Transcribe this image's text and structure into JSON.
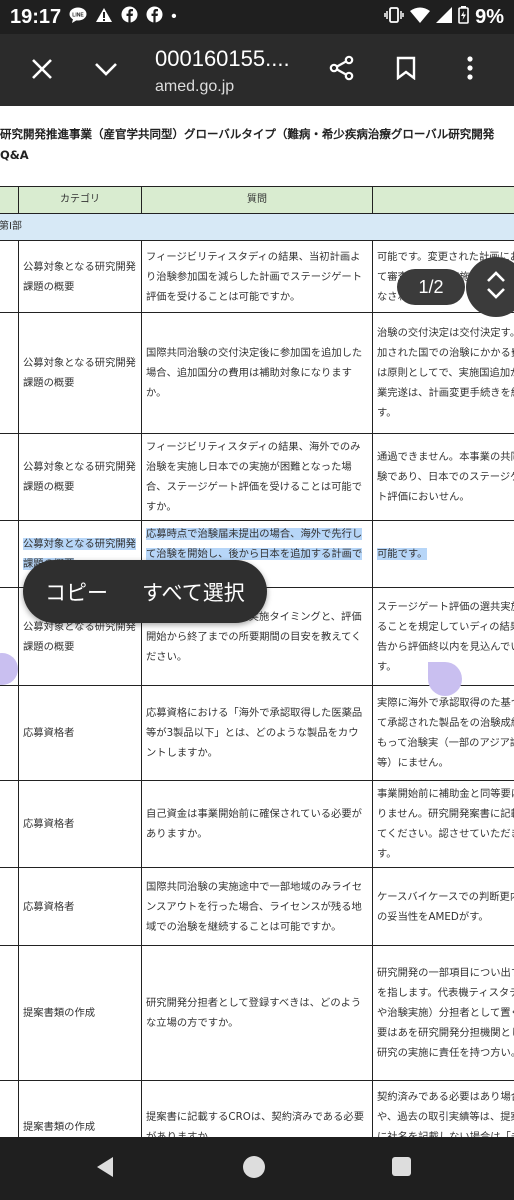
{
  "status_bar": {
    "time": "19:17",
    "dot": "•",
    "battery": "9%",
    "icons": [
      "line-app-icon",
      "alert-triangle-icon",
      "facebook-icon",
      "facebook-icon",
      "vibrate-icon",
      "wifi-icon",
      "signal-icon",
      "battery-charging-icon"
    ]
  },
  "toolbar": {
    "title": "000160155....",
    "url": "amed.go.jp"
  },
  "doc": {
    "title": "研究開発推進事業（産官学共同型）グローバルタイプ（難病・希少疾病治療グローバル研究開発",
    "subtitle": "Q&A"
  },
  "table": {
    "headers": [
      "カテゴリ",
      "質問"
    ],
    "part": "第Ⅰ部",
    "rows": [
      {
        "category": "公募対象となる研究開発課題の概要",
        "question": "フィージビリティスタディの結果、当初計画より治験参加国を減らした計画でステージゲート評価を受けることは可能ですか。",
        "answer": "可能です。変更された計画において審査し、治験実施の交付決定がなされます。"
      },
      {
        "category": "公募対象となる研究開発課題の概要",
        "question": "国際共同治験の交付決定後に参加国を追加した場合、追加国分の費用は補助対象になりますか。",
        "answer": "治験の交付決定は交付決定す。追加された国での治験にかかる費用は原則としてで、実施国追加が事業完遂は、計画変更手続きを経る す。"
      },
      {
        "category": "公募対象となる研究開発課題の概要",
        "question": "フィージビリティスタディの結果、海外でのみ治験を実施し日本での実施が困難となった場合、ステージゲート評価を受けることは可能ですか。",
        "answer": "通過できません。本事業の共同治験であり、日本でのステージゲート評価においせん。"
      },
      {
        "category": "公募対象となる研究開発課題の概要",
        "question": "応募時点で治験届未提出の場合、海外で先行して治験を開始し、後から日本を追加する計画でも応募可能ですか。",
        "answer": "可能です。"
      },
      {
        "category": "公募対象となる研究開発課題の概要",
        "question": "ステージゲート評価の実施タイミングと、評価開始から終了までの所要期間の目安を教えてください。",
        "answer": "ステージゲート評価の選共実施することを規定していディの結果報告から評価終以内を見込んでいます。"
      },
      {
        "category": "応募資格者",
        "question": "応募資格における「海外で承認取得した医薬品等が3製品以下」とは、どのような製品をカウントしますか。",
        "answer": "実際に海外で承認取得のた基づいて承認された製品をの治験成績をもって治験実（一部のアジア諸国等）にません。"
      },
      {
        "category": "応募資格者",
        "question": "自己資金は事業開始前に確保されている必要がありますか。",
        "answer": "事業開始前に補助金と同等要はありません。研究開発案書に記載してください。認させていただきます。"
      },
      {
        "category": "応募資格者",
        "question": "国際共同治験の実施途中で一部地域のみライセンスアウトを行った場合、ライセンスが残る地域での治験を継続することは可能ですか。",
        "answer": "ケースバイケースでの判断更内容の妥当性をAMEDがす。"
      },
      {
        "category": "提案書類の作成",
        "question": "研究開発分担者として登録すべきは、どのような立場の方ですか。",
        "answer": "研究開発の一部項目につい出す方を指します。代表機ティスタディや治験実施）分担者として置く必要はあを研究開発分担機関として研究の実施に責任を持つ方い。"
      },
      {
        "category": "提案書類の作成",
        "question": "提案書に記載するCROは、契約済みである必要がありますか。",
        "answer": "契約済みである必要はあり場合や、過去の取引実績等は、提案書に社名を記載しない場合は「未定」と記載"
      }
    ]
  },
  "page_indicator": "1/2",
  "context_menu": {
    "copy": "コピー",
    "select_all": "すべて選択"
  }
}
